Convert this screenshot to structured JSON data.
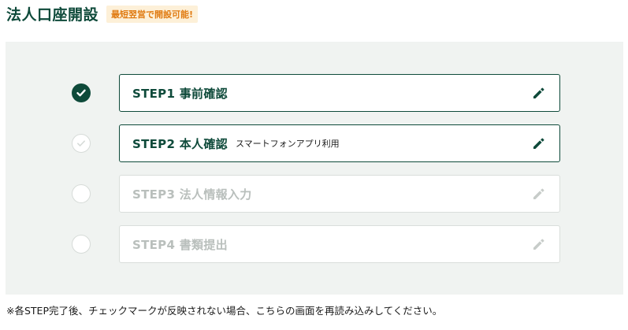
{
  "header": {
    "title": "法人口座開設",
    "badge": "最短翌営で開設可能!"
  },
  "steps": [
    {
      "label": "STEP1  事前確認",
      "note": "",
      "state": "completed",
      "icon": "pencil-icon"
    },
    {
      "label": "STEP2  本人確認",
      "note": "スマートフォンアプリ利用",
      "state": "active",
      "icon": "pencil-icon"
    },
    {
      "label": "STEP3  法人情報入力",
      "note": "",
      "state": "disabled",
      "icon": "pencil-icon"
    },
    {
      "label": "STEP4  書類提出",
      "note": "",
      "state": "disabled",
      "icon": "pencil-icon"
    }
  ],
  "footnote": "※各STEP完了後、チェックマークが反映されない場合、こちらの画面を再読み込みしてください。",
  "colors": {
    "brand": "#0e4a3a",
    "badge_bg": "#fdf0d8",
    "badge_text": "#e07b12",
    "panel_bg": "#f0f3f1",
    "disabled": "#b9bfbc"
  }
}
